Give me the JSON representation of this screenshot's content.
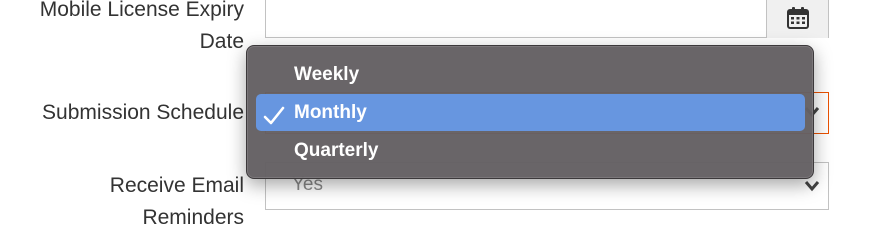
{
  "form": {
    "expiry_label_line1": "Mobile License Expiry",
    "expiry_label_line2": "Date",
    "expiry_value": "",
    "schedule_label": "Submission Schedule",
    "email_label_line1": "Receive Email",
    "email_label_line2": "Reminders",
    "email_value": "Yes"
  },
  "dropdown": {
    "options": [
      "Weekly",
      "Monthly",
      "Quarterly"
    ],
    "selected": "Monthly"
  },
  "icons": {
    "calendar": "calendar-icon",
    "check": "checkmark-icon",
    "chevron": "chevron-down-icon"
  },
  "colors": {
    "focus_border": "#eb5202",
    "highlight": "#6796e0",
    "menu_bg": "#646063"
  }
}
